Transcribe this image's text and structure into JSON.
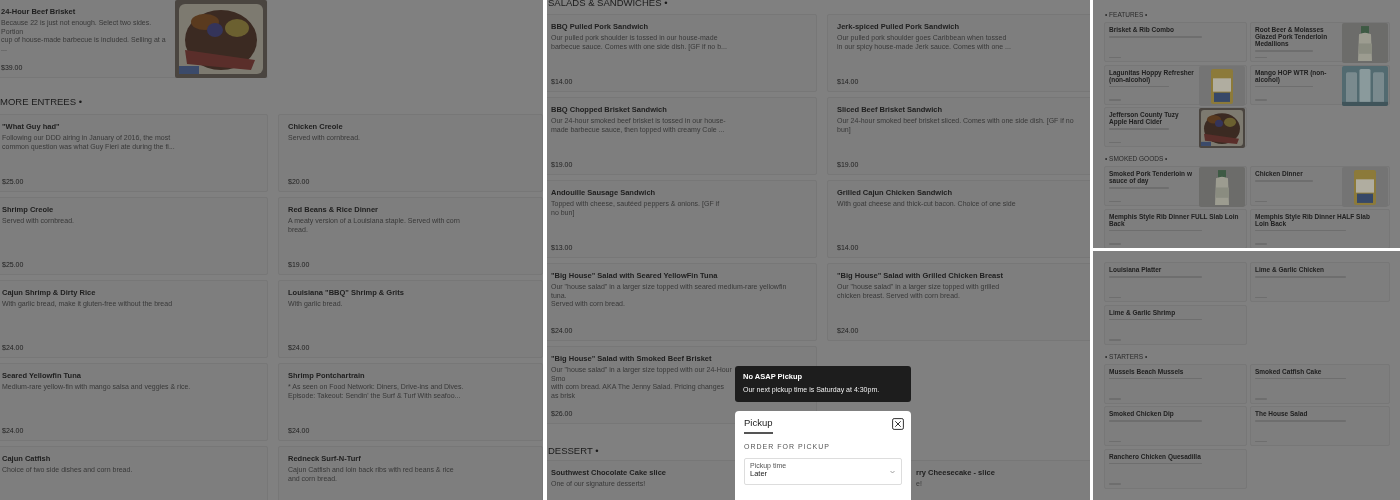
{
  "panels": [
    {
      "kind": "page",
      "sections": [
        {
          "items": [
            {
              "title": "24-Hour Beef Brisket",
              "description": [
                "Because 22 is just not enough. Select two sides. Portion",
                "cup of house-made barbecue is included. Selling at a ..."
              ],
              "price": "$39.00",
              "photo": true
            }
          ]
        },
        {
          "heading": "MORE ENTREES •",
          "items": [
            {
              "title": "\"What Guy had\"",
              "description": [
                "Following our DDD airing in January of 2016, the most",
                "common question was what Guy Fieri ate during the fi..."
              ],
              "price": "$25.00"
            },
            {
              "title": "Chicken Creole",
              "description": [
                "Served with cornbread."
              ],
              "price": "$20.00"
            },
            {
              "title": "Shrimp Creole",
              "description": [
                "Served with cornbread."
              ],
              "price": "$25.00"
            },
            {
              "title": "Red Beans & Rice Dinner",
              "description": [
                "A meaty version of a Louisiana staple. Served with corn",
                "bread."
              ],
              "price": "$19.00"
            },
            {
              "title": "Cajun Shrimp & Dirty Rice",
              "description": [
                "With garlic bread, make it gluten-free without the bread"
              ],
              "price": "$24.00"
            },
            {
              "title": "Louisiana \"BBQ\" Shrimp & Grits",
              "description": [
                "With garlic bread."
              ],
              "price": "$24.00"
            },
            {
              "title": "Seared Yellowfin Tuna",
              "description": [
                "Medium-rare yellow-fin with mango salsa and veggies & rice."
              ],
              "price": "$24.00"
            },
            {
              "title": "Shrimp Pontchartrain",
              "description": [
                "* As seen on Food Network: Diners, Drive-ins and Dives.",
                "Episode: Takeout: Sendin' the Surf & Turf With seafoo..."
              ],
              "price": "$24.00"
            },
            {
              "title": "Cajun Catfish",
              "description": [
                "Choice of two side dishes and corn bread."
              ]
            },
            {
              "title": "Redneck Surf-N-Turf",
              "description": [
                "Cajun Catfish and loin back ribs with red beans & rice",
                "and corn bread."
              ]
            }
          ]
        }
      ]
    },
    {
      "kind": "page",
      "sections": [
        {
          "heading": "SALADS & SANDWICHES •",
          "items": [
            {
              "title": "BBQ Pulled Pork Sandwich",
              "description": [
                "Our pulled pork shoulder is tossed in our house-made",
                "barbecue sauce. Comes with one side dish. [GF if no b..."
              ],
              "price": "$14.00"
            },
            {
              "title": "Jerk-spiced Pulled Pork Sandwich",
              "description": [
                "Our pulled pork shoulder goes Caribbean when tossed",
                "in our spicy house-made Jerk sauce. Comes with one ..."
              ],
              "price": "$14.00"
            },
            {
              "title": "BBQ Chopped Brisket Sandwich",
              "description": [
                "Our 24-hour smoked beef brisket is tossed in our house-",
                "made barbecue sauce, then topped with creamy Cole ..."
              ],
              "price": "$19.00"
            },
            {
              "title": "Sliced Beef Brisket Sandwich",
              "description": [
                "Our 24-hour smoked beef brisket sliced. Comes with one side dish. [GF if no bun]"
              ],
              "price": "$19.00"
            },
            {
              "title": "Andouille Sausage Sandwich",
              "description": [
                "Topped with cheese, sautéed peppers & onions. [GF if",
                "no bun]"
              ],
              "price": "$13.00"
            },
            {
              "title": "Grilled Cajun Chicken Sandwich",
              "description": [
                "With goat cheese and thick-cut bacon. Choice of one side"
              ],
              "price": "$14.00"
            },
            {
              "title": "\"Big House\" Salad with Seared YellowFin Tuna",
              "description": [
                "Our \"house salad\" in a larger size topped with seared medium-rare yellowfin tuna.",
                "Served with corn bread."
              ],
              "price": "$24.00"
            },
            {
              "title": "\"Big House\" Salad with Grilled Chicken Breast",
              "description": [
                "Our \"house salad\" in a larger size topped with grilled",
                "chicken breast. Served with corn bread."
              ],
              "price": "$24.00"
            },
            {
              "title": "\"Big House\" Salad with Smoked Beef Brisket",
              "description": [
                "Our \"house salad\" in a larger size topped with our 24-Hour Smo",
                "with corn bread. AKA The Jenny Salad. Pricing changes as brisk"
              ],
              "price": "$26.00"
            }
          ]
        },
        {
          "heading": "DESSERT •",
          "items": [
            {
              "title": "Southwest Chocolate Cake slice",
              "description": [
                "One of our signature desserts!"
              ]
            },
            {
              "title": "rry Cheesecake - slice",
              "description": [
                "e!"
              ]
            }
          ]
        }
      ],
      "toast": {
        "title": "No ASAP Pickup",
        "message": "Our next pickup time is Saturday at 4:30pm."
      },
      "modal": {
        "title": "Pickup",
        "subtitle": "ORDER FOR PICKUP",
        "field_label": "Pickup time",
        "field_value": "Later"
      }
    },
    {
      "kind": "thumbnail",
      "sections": [
        {
          "heading": "• FEATURES •",
          "items": [
            {
              "title": "Brisket & Rib Combo"
            },
            {
              "title": "Root Beer & Molasses Glazed Pork Tenderloin Medallions",
              "photo": true
            },
            {
              "title": "Lagunitas Hoppy Refresher (non-alcohol)",
              "photo": true
            },
            {
              "title": "Mango HOP WTR (non-alcohol)",
              "photo": true
            },
            {
              "title": "Jefferson County Tuzy Apple Hard Cider",
              "photo": true
            }
          ]
        },
        {
          "heading": "• SMOKED GOODS •",
          "items": [
            {
              "title": "Smoked Pork Tenderloin w sauce of day",
              "photo": true
            },
            {
              "title": "Chicken Dinner",
              "photo": true
            },
            {
              "title": "Memphis Style Rib Dinner FULL Slab Loin Back"
            },
            {
              "title": "Memphis Style Rib Dinner HALF Slab Loin Back"
            }
          ]
        }
      ]
    },
    {
      "kind": "thumbnail",
      "sections": [
        {
          "items": [
            {
              "title": "Louisiana Platter"
            },
            {
              "title": "Lime & Garlic Chicken"
            },
            {
              "title": "Lime & Garlic Shrimp"
            }
          ]
        },
        {
          "heading": "• STARTERS •",
          "items": [
            {
              "title": "Mussels Beach Mussels"
            },
            {
              "title": "Smoked Catfish Cake"
            },
            {
              "title": "Smoked Chicken Dip"
            },
            {
              "title": "The House Salad"
            },
            {
              "title": "Ranchero Chicken Quesadilla"
            }
          ]
        }
      ]
    }
  ]
}
